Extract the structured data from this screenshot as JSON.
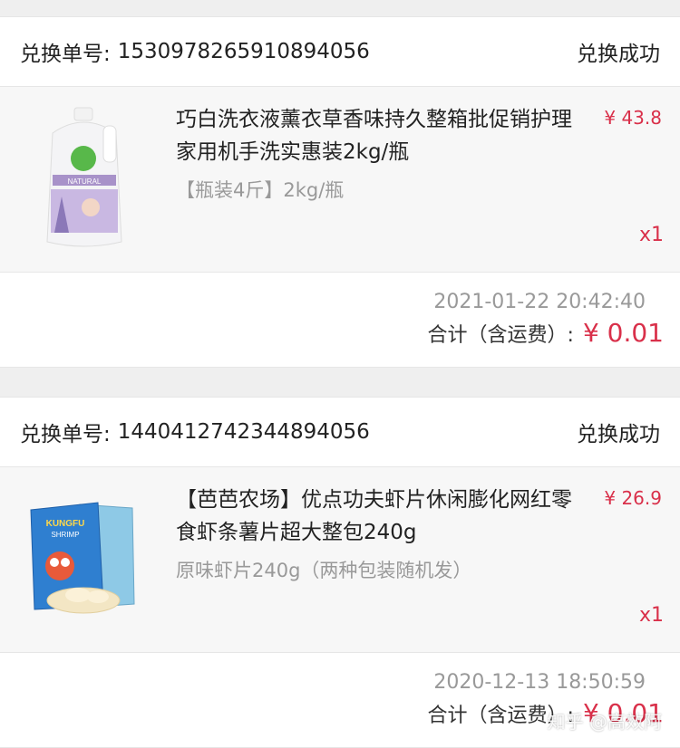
{
  "orders": [
    {
      "order_label": "兑换单号:",
      "order_no": "1530978265910894056",
      "status": "兑换成功",
      "item": {
        "title": "巧白洗衣液薰衣草香味持久整箱批促销护理家用机手洗实惠装2kg/瓶",
        "spec": "【瓶装4斤】2kg/瓶",
        "price": "¥ 43.8",
        "qty": "x1",
        "image": "laundry-detergent-bottle",
        "image_text": "NATURAL"
      },
      "time": "2021-01-22 20:42:40",
      "total_label": "合计（含运费）:",
      "total_amount": "¥ 0.01"
    },
    {
      "order_label": "兑换单号:",
      "order_no": "1440412742344894056",
      "status": "兑换成功",
      "item": {
        "title": "【芭芭农场】优点功夫虾片休闲膨化网红零食虾条薯片超大整包240g",
        "spec": "原味虾片240g（两种包装随机发）",
        "price": "¥ 26.9",
        "qty": "x1",
        "image": "shrimp-chips-bags",
        "image_text": "KUNGFU SHRIMP"
      },
      "time": "2020-12-13 18:50:59",
      "total_label": "合计（含运费）:",
      "total_amount": "¥ 0.01"
    }
  ],
  "watermark": "知乎 @高效阿",
  "colors": {
    "price": "#d9304a",
    "muted": "#999999",
    "background": "#efefef"
  }
}
